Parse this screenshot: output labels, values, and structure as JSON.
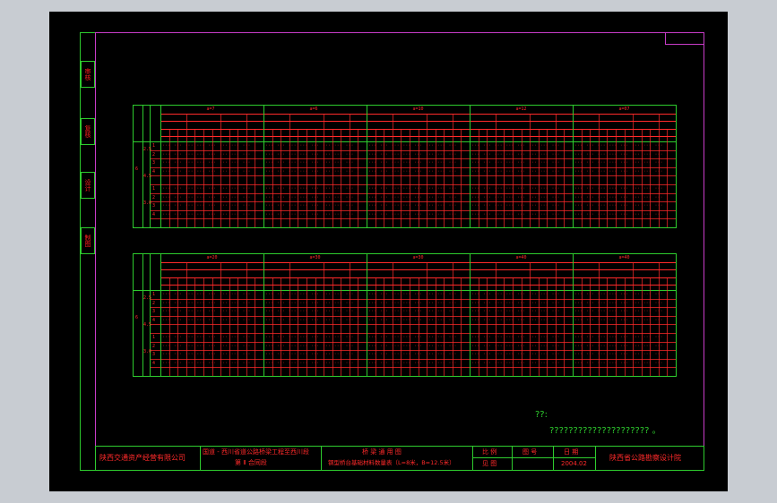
{
  "drawing": {
    "side_tabs": [
      "审核",
      "复核",
      "设计",
      "制图"
    ],
    "tables": [
      {
        "id": "upper",
        "spans": [
          "a=7",
          "a=6",
          "a=10",
          "a=12",
          "a=07"
        ],
        "rows": [
          "1",
          "2",
          "3",
          "4",
          "1",
          "2",
          "3",
          "4"
        ],
        "left_labels": [
          "2.5",
          "4.5",
          "3.0"
        ],
        "side_value": "6"
      },
      {
        "id": "lower",
        "spans": [
          "a=20",
          "a=30",
          "a=30",
          "a=40",
          "a=40"
        ],
        "rows": [
          "1",
          "2",
          "3",
          "4",
          "1",
          "2",
          "3",
          "4"
        ],
        "left_labels": [
          "2.5",
          "4.5",
          "3.0"
        ],
        "side_value": "6"
      }
    ],
    "notes": {
      "line1": "??:",
      "line2": "?????????????????????  。"
    },
    "title_block": {
      "company": "陕西交通资产经营有限公司",
      "project_line1": "国道 - 西川省道公路桥梁工程至西川段",
      "project_line2": "第 Ⅱ 合同段",
      "drawing_title_1": "桥 梁 通 用 图",
      "drawing_title_2": "钢型桥台基础材料数量表（L=8米，B=12.5米）",
      "scale_label": "比 例",
      "sheet_label": "图 号",
      "date_label": "日 期",
      "scale_value": "见 图",
      "date_value": "2004.02",
      "designer": "陕西省公路勘察设计院"
    },
    "colors": {
      "frame": "#2ecc2e",
      "inner_frame": "#c83cc8",
      "text": "#ff2a2a",
      "background": "#000000"
    }
  }
}
